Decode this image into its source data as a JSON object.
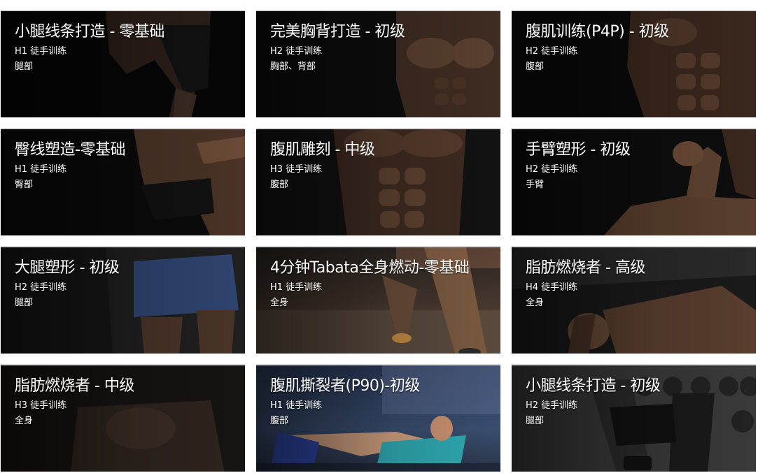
{
  "courses": [
    {
      "title": "小腿线条打造 - 零基础",
      "level": "H1",
      "type": "徒手训练",
      "part": "腿部",
      "bg_color": "#0a0a0a",
      "body_color": "#3a2a22",
      "image": "legs-runner-image"
    },
    {
      "title": "完美胸背打造 - 初级",
      "level": "H2",
      "type": "徒手训练",
      "part": "胸部、背部",
      "bg_color": "#121212",
      "body_color": "#5a4030",
      "image": "chest-torso-image"
    },
    {
      "title": "腹肌训练(P4P) - 初级",
      "level": "H2",
      "type": "徒手训练",
      "part": "腹部",
      "bg_color": "#0e0e0e",
      "body_color": "#4a3326",
      "image": "abs-torso-image"
    },
    {
      "title": "臀线塑造-零基础",
      "level": "H1",
      "type": "徒手训练",
      "part": "臀部",
      "bg_color": "#0c0c0c",
      "body_color": "#6a4a36",
      "image": "glutes-image"
    },
    {
      "title": "腹肌雕刻 - 中级",
      "level": "H3",
      "type": "徒手训练",
      "part": "腹部",
      "bg_color": "#141414",
      "body_color": "#5a3e2e",
      "image": "abs-sculpt-image"
    },
    {
      "title": "手臂塑形 - 初级",
      "level": "H2",
      "type": "徒手训练",
      "part": "手臂",
      "bg_color": "#101010",
      "body_color": "#5e4230",
      "image": "arm-flex-image"
    },
    {
      "title": "大腿塑形 - 初级",
      "level": "H2",
      "type": "徒手训练",
      "part": "腿部",
      "bg_color": "#1a1a1a",
      "body_color": "#3a4f7a",
      "image": "thighs-image"
    },
    {
      "title": "4分钟Tabata全身燃动-零基础",
      "level": "H1",
      "type": "徒手训练",
      "part": "全身",
      "bg_color": "#3a3530",
      "body_color": "#8a6a4a",
      "image": "sprinter-image"
    },
    {
      "title": "脂肪燃烧者 - 高级",
      "level": "H4",
      "type": "徒手训练",
      "part": "全身",
      "bg_color": "#1a1a1a",
      "body_color": "#6a4c38",
      "image": "pushup-image"
    },
    {
      "title": "脂肪燃烧者 - 中级",
      "level": "H3",
      "type": "徒手训练",
      "part": "全身",
      "bg_color": "#1a1816",
      "body_color": "#3a2c24",
      "image": "dark-workout-image"
    },
    {
      "title": "腹肌撕裂者(P90)-初级",
      "level": "H1",
      "type": "徒手训练",
      "part": "腹部",
      "bg_color": "#2a3a56",
      "body_color": "#2fa8b0",
      "image": "gym-situp-image"
    },
    {
      "title": "小腿线条打造 - 初级",
      "level": "H2",
      "type": "徒手训练",
      "part": "腿部",
      "bg_color": "#3a3a3a",
      "body_color": "#2a2a2a",
      "image": "dumbbell-legs-image"
    }
  ],
  "level_labels": [
    "H1 徒手训练",
    "H2 徒手训练",
    "H2 徒手训练",
    "H1 徒手训练",
    "H3 徒手训练",
    "H2 徒手训练",
    "H2 徒手训练",
    "H1 徒手训练",
    "H4 徒手训练",
    "H3 徒手训练",
    "H1 徒手训练",
    "H2 徒手训练"
  ]
}
